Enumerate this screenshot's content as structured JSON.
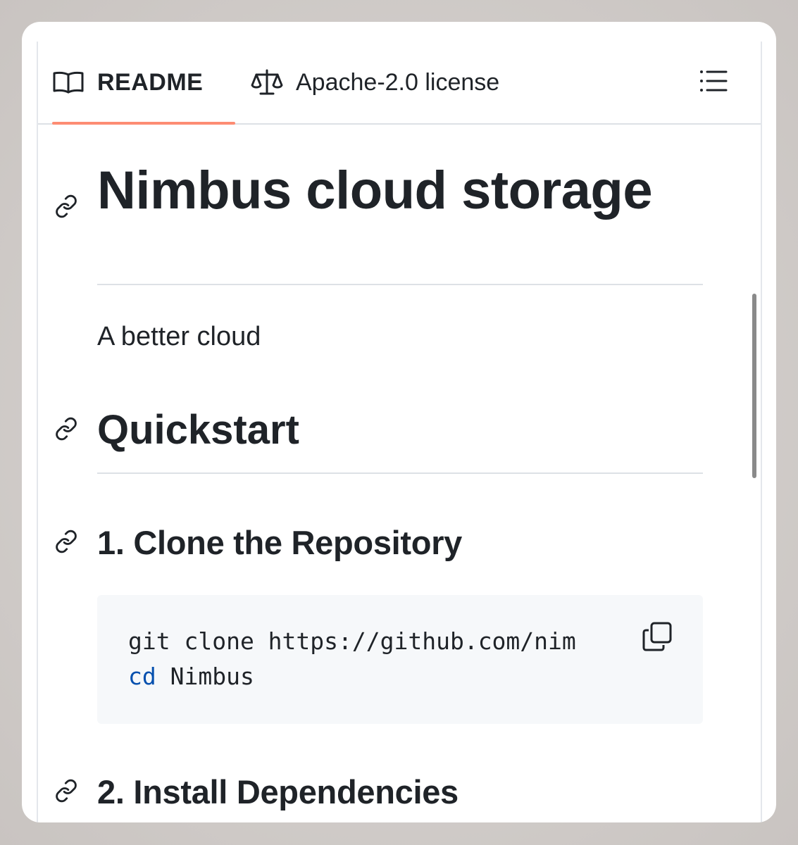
{
  "tabs": {
    "readme_label": "README",
    "license_label": "Apache-2.0 license"
  },
  "icons": {
    "readme": "book-icon",
    "license": "scale-icon",
    "outline": "list-icon",
    "anchor": "link-icon",
    "copy": "copy-icon"
  },
  "colors": {
    "active_tab_underline": "#fd8c73",
    "code_keyword": "#0550ae",
    "code_background": "#f6f8fa",
    "text": "#1f2328"
  },
  "readme": {
    "title": "Nimbus cloud storage",
    "tagline": "A better cloud",
    "quickstart_heading": "Quickstart",
    "step1_heading": "1. Clone the Repository",
    "step1_code": {
      "line1": "git clone https://github.com/nim",
      "line2_keyword": "cd",
      "line2_rest": " Nimbus"
    },
    "step2_heading": "2. Install Dependencies"
  }
}
